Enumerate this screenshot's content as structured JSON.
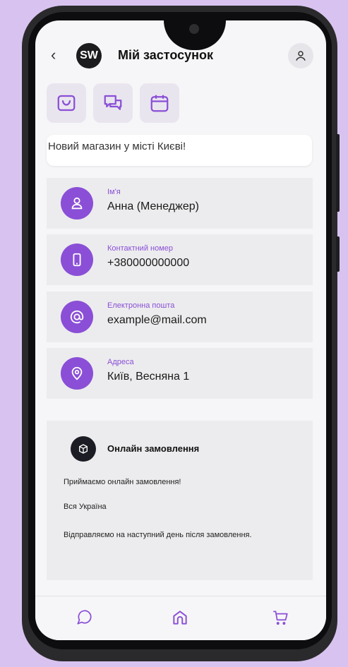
{
  "header": {
    "back_glyph": "‹",
    "logo_text": "SW",
    "title": "Мій застосунок"
  },
  "quick_actions": [
    {
      "name": "shopping-bag-icon"
    },
    {
      "name": "chat-bubbles-icon"
    },
    {
      "name": "calendar-icon"
    }
  ],
  "banner": {
    "text": "Новий магазин у місті Києві!"
  },
  "contacts": [
    {
      "label": "Ім'я",
      "value": "Анна (Менеджер)",
      "icon": "user-icon"
    },
    {
      "label": "Контактний номер",
      "value": "+380000000000",
      "icon": "phone-icon"
    },
    {
      "label": "Електронна пошта",
      "value": "example@mail.com",
      "icon": "at-icon"
    },
    {
      "label": "Адреса",
      "value": "Київ, Весняна 1",
      "icon": "location-pin-icon"
    }
  ],
  "online": {
    "title": "Онлайн замовлення",
    "lines": [
      "Приймаємо онлайн замовлення!",
      "Вся Україна",
      "Відправляємо на наступний день після замовлення."
    ]
  },
  "tabs": [
    {
      "name": "chat-icon"
    },
    {
      "name": "home-icon"
    },
    {
      "name": "cart-icon"
    }
  ],
  "colors": {
    "accent": "#8a4fd6",
    "background": "#d8c3f0",
    "row_bg": "#ececee"
  }
}
